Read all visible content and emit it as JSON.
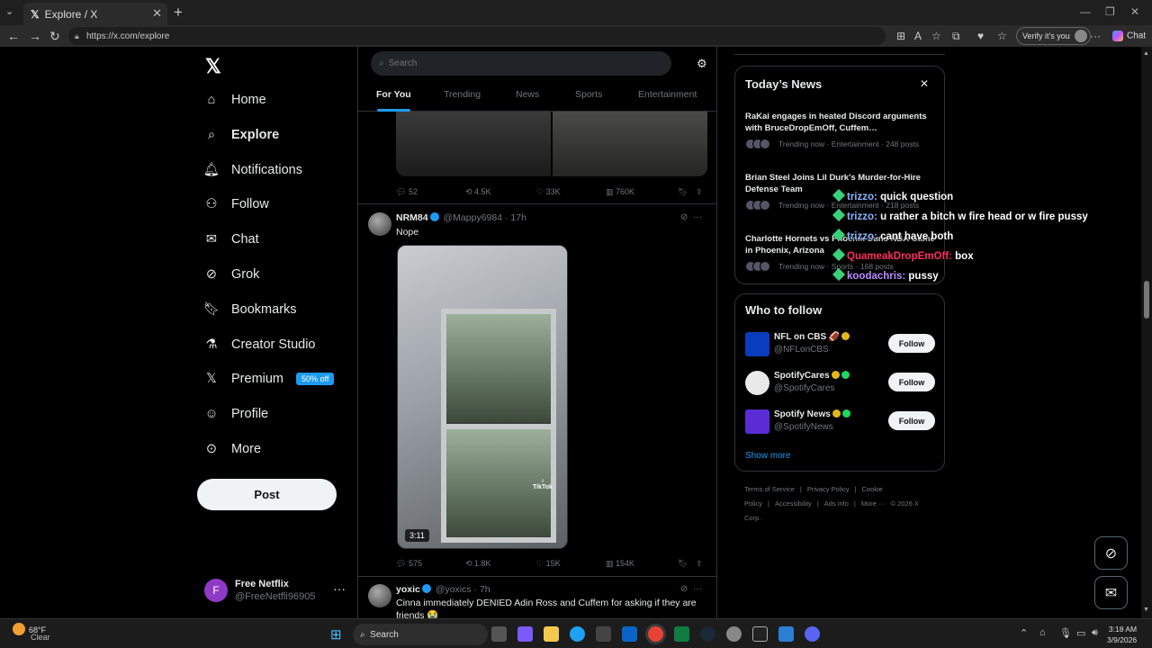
{
  "browser": {
    "tab_title": "Explore / X",
    "url": "https://x.com/explore",
    "verify_label": "Verify it's you",
    "chat_label": "Chat"
  },
  "nav": {
    "items": [
      {
        "label": "Home",
        "icon": "home-icon"
      },
      {
        "label": "Explore",
        "icon": "search-icon"
      },
      {
        "label": "Notifications",
        "icon": "bell-icon"
      },
      {
        "label": "Follow",
        "icon": "person-add-icon"
      },
      {
        "label": "Chat",
        "icon": "mail-icon"
      },
      {
        "label": "Grok",
        "icon": "grok-icon"
      },
      {
        "label": "Bookmarks",
        "icon": "bookmark-icon"
      },
      {
        "label": "Creator Studio",
        "icon": "creator-icon"
      },
      {
        "label": "Premium",
        "icon": "x-icon"
      },
      {
        "label": "Profile",
        "icon": "person-icon"
      },
      {
        "label": "More",
        "icon": "more-circle-icon"
      }
    ],
    "premium_badge": "50% off",
    "post_label": "Post",
    "account": {
      "initial": "F",
      "name": "Free Netflix",
      "handle": "@FreeNetfli96905"
    }
  },
  "explore": {
    "search_placeholder": "Search",
    "tabs": [
      "For You",
      "Trending",
      "News",
      "Sports",
      "Entertainment"
    ]
  },
  "tweets": [
    {
      "replies": "52",
      "reposts": "4.5K",
      "likes": "33K",
      "views": "760K"
    },
    {
      "name": "NRM84",
      "handle": "@Mappy6984",
      "time": "· 17h",
      "text": "Nope",
      "duration": "3:11",
      "watermark": "TikTok",
      "replies": "575",
      "reposts": "1.8K",
      "likes": "15K",
      "views": "154K"
    },
    {
      "name": "yoxic",
      "handle": "@yoxics",
      "time": "· 7h",
      "text": "Cinna immediately DENIED Adin Ross and Cuffem for asking if they are friends 😭"
    }
  ],
  "news": {
    "title": "Today’s News",
    "items": [
      {
        "title": "RaKai engages in heated Discord arguments with BruceDropEmOff, Cuffem…",
        "meta": "Trending now · Entertainment · 248 posts"
      },
      {
        "title": "Brian Steel Joins Lil Durk's Murder-for-Hire Defense Team",
        "meta": "Trending now · Entertainment · 218 posts"
      },
      {
        "title": "Charlotte Hornets vs Phoenix Suns NBA Game in Phoenix, Arizona",
        "meta": "Trending now · Sports · 168 posts"
      }
    ]
  },
  "who_to_follow": {
    "title": "Who to follow",
    "items": [
      {
        "name": "NFL on CBS 🏈",
        "handle": "@NFLonCBS",
        "button": "Follow",
        "color": "#0a3dbd"
      },
      {
        "name": "SpotifyCares",
        "handle": "@SpotifyCares",
        "button": "Follow",
        "color": "#e9e9e9"
      },
      {
        "name": "Spotify News",
        "handle": "@SpotifyNews",
        "button": "Follow",
        "color": "#5b2bd6"
      }
    ],
    "show_more": "Show more"
  },
  "footer": {
    "links": [
      "Terms of Service",
      "|",
      "Privacy Policy",
      "|",
      "Cookie Policy",
      "|",
      "Accessibility",
      "|",
      "Ads info",
      "|",
      "More ···",
      "© 2026 X Corp."
    ]
  },
  "chat_overlay": [
    {
      "user": "trizzo:",
      "msg": "quick question",
      "color": "#8fb3ff"
    },
    {
      "user": "trizzo:",
      "msg": "u rather a bitch w fire head or w fire pussy",
      "color": "#8fb3ff"
    },
    {
      "user": "trizzo:",
      "msg": "cant have both",
      "color": "#8fb3ff"
    },
    {
      "user": "QuameakDropEmOff:",
      "msg": "box",
      "color": "#ff2e5f"
    },
    {
      "user": "koodachris:",
      "msg": "pussy",
      "color": "#b98cff"
    }
  ],
  "taskbar": {
    "temp": "68°F",
    "condition": "Clear",
    "search_label": "Search",
    "time": "3:18 AM",
    "date": "3/9/2026",
    "weather_badge": "6"
  }
}
